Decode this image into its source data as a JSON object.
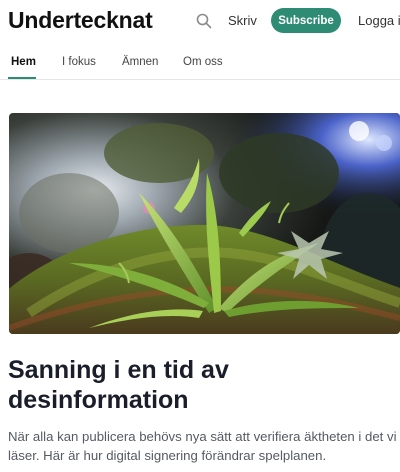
{
  "header": {
    "brand": "Undertecknat",
    "write_label": "Skriv",
    "subscribe_label": "Subscribe",
    "login_label": "Logga in"
  },
  "nav": {
    "tabs": [
      {
        "label": "Hem",
        "active": true
      },
      {
        "label": "I fokus",
        "active": false
      },
      {
        "label": "Ämnen",
        "active": false
      },
      {
        "label": "Om oss",
        "active": false
      }
    ]
  },
  "article": {
    "title": "Sanning i en tid av desinformation",
    "summary": "När alla kan publicera behövs nya sätt att verifiera äktheten i det vi läser. Här är hur digital signering förändrar spelplanen."
  },
  "colors": {
    "accent": "#2e8b74",
    "headline": "#1a1e2a",
    "muted_text": "#555a63"
  },
  "icons": {
    "search": "search-icon"
  }
}
